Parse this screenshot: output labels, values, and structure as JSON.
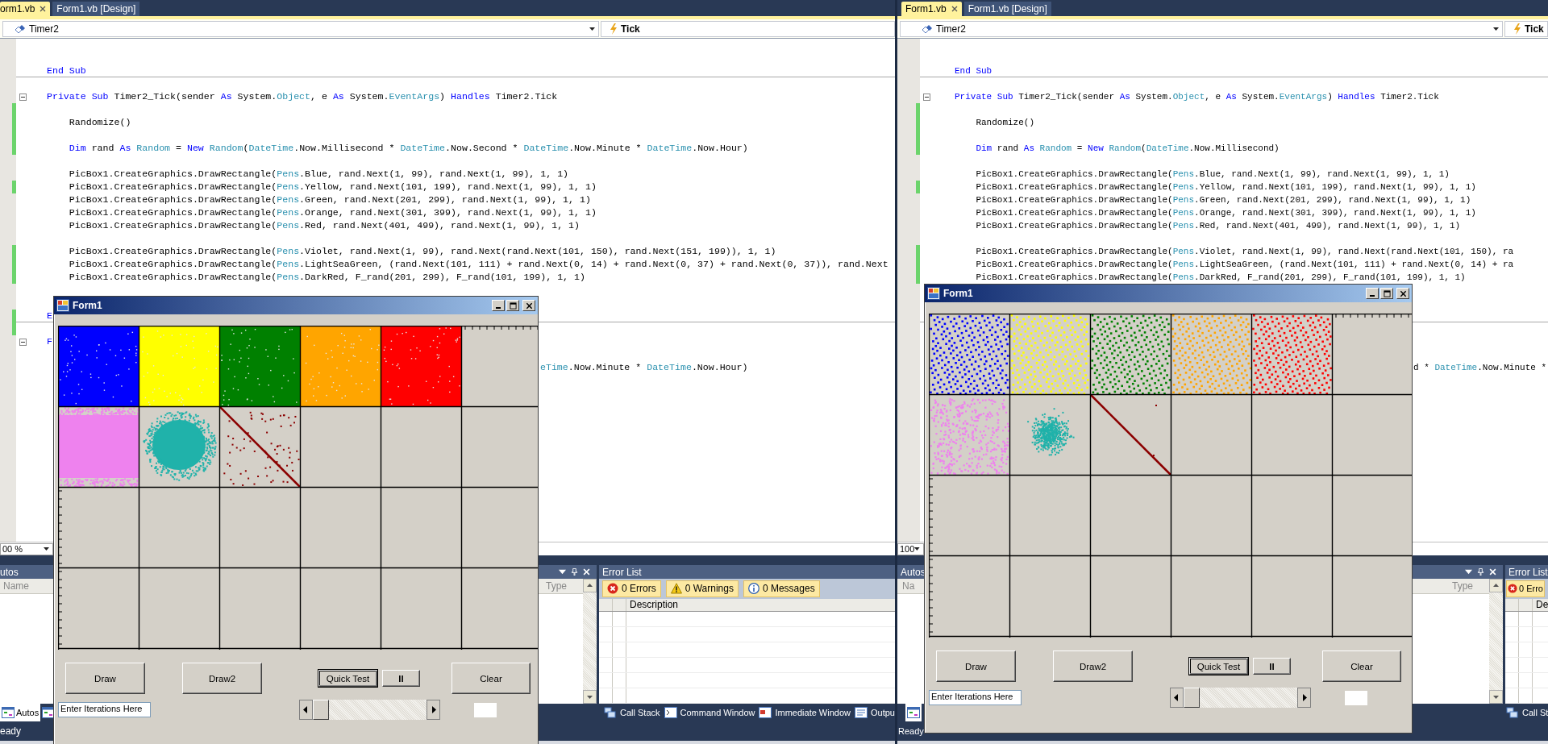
{
  "ides": [
    {
      "tabs": [
        {
          "label": "orm1.vb",
          "selected": true
        },
        {
          "label": "Form1.vb [Design]",
          "selected": false
        }
      ],
      "object_dropdown": "Timer2",
      "event_dropdown": "Tick",
      "code_lines": [
        {
          "kind": "blank",
          "indented": false,
          "changed": false,
          "collapsible": false,
          "divider": false
        },
        {
          "kind": "blank",
          "indented": false,
          "changed": false,
          "collapsible": false,
          "divider": false
        },
        {
          "kind": "code",
          "indented": false,
          "changed": false,
          "collapsible": false,
          "divider": true,
          "tokens": [
            {
              "text": "End Sub",
              "kind": "keyword"
            }
          ]
        },
        {
          "kind": "blank",
          "indented": false,
          "changed": false,
          "collapsible": false,
          "divider": false
        },
        {
          "kind": "code",
          "indented": false,
          "changed": false,
          "collapsible": true,
          "divider": false,
          "tokens": [
            {
              "text": "Private Sub",
              "kind": "keyword"
            },
            {
              "text": " Timer2_Tick(sender ",
              "kind": "plain"
            },
            {
              "text": "As",
              "kind": "keyword"
            },
            {
              "text": " System.",
              "kind": "plain"
            },
            {
              "text": "Object",
              "kind": "type"
            },
            {
              "text": ", e ",
              "kind": "plain"
            },
            {
              "text": "As",
              "kind": "keyword"
            },
            {
              "text": " System.",
              "kind": "plain"
            },
            {
              "text": "EventArgs",
              "kind": "type"
            },
            {
              "text": ") ",
              "kind": "plain"
            },
            {
              "text": "Handles",
              "kind": "keyword"
            },
            {
              "text": " Timer2.Tick",
              "kind": "plain"
            }
          ]
        },
        {
          "kind": "blank",
          "indented": false,
          "changed": true,
          "collapsible": false,
          "divider": false
        },
        {
          "kind": "code",
          "indented": true,
          "changed": true,
          "collapsible": false,
          "divider": false,
          "tokens": [
            {
              "text": "Randomize()",
              "kind": "plain"
            }
          ]
        },
        {
          "kind": "blank",
          "indented": false,
          "changed": true,
          "collapsible": false,
          "divider": false
        },
        {
          "kind": "code",
          "indented": true,
          "changed": true,
          "collapsible": false,
          "divider": false,
          "tokens": [
            {
              "text": "Dim",
              "kind": "keyword"
            },
            {
              "text": " rand ",
              "kind": "plain"
            },
            {
              "text": "As",
              "kind": "keyword"
            },
            {
              "text": " Random",
              "kind": "type"
            },
            {
              "text": " = ",
              "kind": "plain"
            },
            {
              "text": "New",
              "kind": "keyword"
            },
            {
              "text": " Random",
              "kind": "type"
            },
            {
              "text": "(",
              "kind": "plain"
            },
            {
              "text": "DateTime",
              "kind": "type"
            },
            {
              "text": ".Now.Millisecond * ",
              "kind": "plain"
            },
            {
              "text": "DateTime",
              "kind": "type"
            },
            {
              "text": ".Now.Second * ",
              "kind": "plain"
            },
            {
              "text": "DateTime",
              "kind": "type"
            },
            {
              "text": ".Now.Minute * ",
              "kind": "plain"
            },
            {
              "text": "DateTime",
              "kind": "type"
            },
            {
              "text": ".Now.Hour)",
              "kind": "plain"
            }
          ]
        },
        {
          "kind": "blank",
          "indented": false,
          "changed": false,
          "collapsible": false,
          "divider": false
        },
        {
          "kind": "code",
          "indented": true,
          "changed": false,
          "collapsible": false,
          "divider": false,
          "tokens": [
            {
              "text": "PicBox1.CreateGraphics.DrawRectangle(",
              "kind": "plain"
            },
            {
              "text": "Pens",
              "kind": "type"
            },
            {
              "text": ".Blue, rand.Next(1, 99), rand.Next(1, 99), 1, 1)",
              "kind": "plain"
            }
          ]
        },
        {
          "kind": "code",
          "indented": true,
          "changed": true,
          "collapsible": false,
          "divider": false,
          "tokens": [
            {
              "text": "PicBox1.CreateGraphics.DrawRectangle(",
              "kind": "plain"
            },
            {
              "text": "Pens",
              "kind": "type"
            },
            {
              "text": ".Yellow, rand.Next(101, 199), rand.Next(1, 99), 1, 1)",
              "kind": "plain"
            }
          ]
        },
        {
          "kind": "code",
          "indented": true,
          "changed": false,
          "collapsible": false,
          "divider": false,
          "tokens": [
            {
              "text": "PicBox1.CreateGraphics.DrawRectangle(",
              "kind": "plain"
            },
            {
              "text": "Pens",
              "kind": "type"
            },
            {
              "text": ".Green, rand.Next(201, 299), rand.Next(1, 99), 1, 1)",
              "kind": "plain"
            }
          ]
        },
        {
          "kind": "code",
          "indented": true,
          "changed": false,
          "collapsible": false,
          "divider": false,
          "tokens": [
            {
              "text": "PicBox1.CreateGraphics.DrawRectangle(",
              "kind": "plain"
            },
            {
              "text": "Pens",
              "kind": "type"
            },
            {
              "text": ".Orange, rand.Next(301, 399), rand.Next(1, 99), 1, 1)",
              "kind": "plain"
            }
          ]
        },
        {
          "kind": "code",
          "indented": true,
          "changed": false,
          "collapsible": false,
          "divider": false,
          "tokens": [
            {
              "text": "PicBox1.CreateGraphics.DrawRectangle(",
              "kind": "plain"
            },
            {
              "text": "Pens",
              "kind": "type"
            },
            {
              "text": ".Red, rand.Next(401, 499), rand.Next(1, 99), 1, 1)",
              "kind": "plain"
            }
          ]
        },
        {
          "kind": "blank",
          "indented": false,
          "changed": false,
          "collapsible": false,
          "divider": false
        },
        {
          "kind": "code",
          "indented": true,
          "changed": true,
          "collapsible": false,
          "divider": false,
          "tokens": [
            {
              "text": "PicBox1.CreateGraphics.DrawRectangle(",
              "kind": "plain"
            },
            {
              "text": "Pens",
              "kind": "type"
            },
            {
              "text": ".Violet, rand.Next(1, 99), rand.Next(rand.Next(101, 150), rand.Next(151, 199)), 1, 1)",
              "kind": "plain"
            }
          ]
        },
        {
          "kind": "code",
          "indented": true,
          "changed": true,
          "collapsible": false,
          "divider": false,
          "tokens": [
            {
              "text": "PicBox1.CreateGraphics.DrawRectangle(",
              "kind": "plain"
            },
            {
              "text": "Pens",
              "kind": "type"
            },
            {
              "text": ".LightSeaGreen, (rand.Next(101, 111) + rand.Next(0, 14) + rand.Next(0, 37) + rand.Next(0, 37)), rand.Next",
              "kind": "plain"
            }
          ]
        },
        {
          "kind": "code",
          "indented": true,
          "changed": true,
          "collapsible": false,
          "divider": false,
          "tokens": [
            {
              "text": "PicBox1.CreateGraphics.DrawRectangle(",
              "kind": "plain"
            },
            {
              "text": "Pens",
              "kind": "type"
            },
            {
              "text": ".DarkRed, F_rand(201, 299), F_rand(101, 199), 1, 1)",
              "kind": "plain"
            }
          ]
        },
        {
          "kind": "blank",
          "indented": false,
          "changed": false,
          "collapsible": false,
          "divider": false
        },
        {
          "kind": "blank",
          "indented": false,
          "changed": false,
          "collapsible": false,
          "divider": false
        },
        {
          "kind": "code",
          "indented": false,
          "changed": true,
          "collapsible": false,
          "divider": true,
          "tokens": [
            {
              "text": "E",
              "kind": "keyword"
            }
          ]
        },
        {
          "kind": "blank",
          "indented": false,
          "changed": true,
          "collapsible": false,
          "divider": false
        },
        {
          "kind": "code",
          "indented": false,
          "changed": false,
          "collapsible": true,
          "divider": false,
          "tokens": [
            {
              "text": "F",
              "kind": "keyword"
            }
          ]
        },
        {
          "kind": "blank",
          "indented": false,
          "changed": false,
          "collapsible": false,
          "divider": false
        },
        {
          "kind": "tail",
          "indented": false,
          "changed": false,
          "collapsible": false,
          "divider": false,
          "tokens": [
            {
              "text": "eTime",
              "kind": "type"
            },
            {
              "text": ".Now.Minute * ",
              "kind": "plain"
            },
            {
              "text": "DateTime",
              "kind": "type"
            },
            {
              "text": ".Now.Hour)",
              "kind": "plain"
            }
          ]
        }
      ],
      "zoom": "00 %",
      "autos": {
        "title": "utos",
        "columns": [
          "Name",
          "Type"
        ]
      },
      "error_list": {
        "title": "Error List",
        "filters": [
          {
            "kind": "error",
            "label": "0 Errors"
          },
          {
            "kind": "warning",
            "label": "0 Warnings"
          },
          {
            "kind": "info",
            "label": "0 Messages"
          }
        ],
        "columns": [
          "Description"
        ]
      },
      "bottom_tabs": [
        {
          "label": "Autos",
          "selected": true
        },
        {
          "selected": false
        }
      ],
      "tool_tabs": [
        {
          "kind": "stack",
          "label": "Call Stack"
        },
        {
          "kind": "command",
          "label": "Command Window"
        },
        {
          "kind": "immediate",
          "label": "Immediate Window"
        },
        {
          "kind": "output",
          "label": "Outpu"
        }
      ],
      "status": "eady",
      "form": {
        "title": "Form1",
        "cells": [
          {
            "kind": "solid",
            "color": "#0000ff"
          },
          {
            "kind": "solid",
            "color": "#ffff00"
          },
          {
            "kind": "solid",
            "color": "#008000"
          },
          {
            "kind": "solid",
            "color": "#ffa500"
          },
          {
            "kind": "solid",
            "color": "#ff0000"
          },
          {
            "kind": "band",
            "color": "#ee82ee"
          },
          {
            "kind": "blob",
            "color": "#20b2aa"
          },
          {
            "kind": "diagonal",
            "color": "#8b0000"
          }
        ],
        "buttons": [
          {
            "label": "Draw",
            "focused": false
          },
          {
            "label": "Draw2",
            "focused": false
          },
          {
            "label": "Quick Test",
            "focused": true
          },
          {
            "label": "II",
            "focused": false
          },
          {
            "label": "Clear",
            "focused": false
          }
        ],
        "iterations": "Enter Iterations Here"
      }
    },
    {
      "tabs": [
        {
          "label": "Form1.vb",
          "selected": true
        },
        {
          "label": "Form1.vb [Design]",
          "selected": false
        }
      ],
      "object_dropdown": "Timer2",
      "event_dropdown": "Tick",
      "code_lines": [
        {
          "kind": "blank",
          "indented": false,
          "changed": false,
          "collapsible": false,
          "divider": false
        },
        {
          "kind": "blank",
          "indented": false,
          "changed": false,
          "collapsible": false,
          "divider": false
        },
        {
          "kind": "code",
          "indented": false,
          "changed": false,
          "collapsible": false,
          "divider": true,
          "tokens": [
            {
              "text": "End Sub",
              "kind": "keyword"
            }
          ]
        },
        {
          "kind": "blank",
          "indented": false,
          "changed": false,
          "collapsible": false,
          "divider": false
        },
        {
          "kind": "code",
          "indented": false,
          "changed": false,
          "collapsible": true,
          "divider": false,
          "tokens": [
            {
              "text": "Private Sub",
              "kind": "keyword"
            },
            {
              "text": " Timer2_Tick(sender ",
              "kind": "plain"
            },
            {
              "text": "As",
              "kind": "keyword"
            },
            {
              "text": " System.",
              "kind": "plain"
            },
            {
              "text": "Object",
              "kind": "type"
            },
            {
              "text": ", e ",
              "kind": "plain"
            },
            {
              "text": "As",
              "kind": "keyword"
            },
            {
              "text": " System.",
              "kind": "plain"
            },
            {
              "text": "EventArgs",
              "kind": "type"
            },
            {
              "text": ") ",
              "kind": "plain"
            },
            {
              "text": "Handles",
              "kind": "keyword"
            },
            {
              "text": " Timer2.Tick",
              "kind": "plain"
            }
          ]
        },
        {
          "kind": "blank",
          "indented": false,
          "changed": true,
          "collapsible": false,
          "divider": false
        },
        {
          "kind": "code",
          "indented": true,
          "changed": true,
          "collapsible": false,
          "divider": false,
          "tokens": [
            {
              "text": "Randomize()",
              "kind": "plain"
            }
          ]
        },
        {
          "kind": "blank",
          "indented": false,
          "changed": true,
          "collapsible": false,
          "divider": false
        },
        {
          "kind": "code",
          "indented": true,
          "changed": true,
          "collapsible": false,
          "divider": false,
          "tokens": [
            {
              "text": "Dim",
              "kind": "keyword"
            },
            {
              "text": " rand ",
              "kind": "plain"
            },
            {
              "text": "As",
              "kind": "keyword"
            },
            {
              "text": " Random",
              "kind": "type"
            },
            {
              "text": " = ",
              "kind": "plain"
            },
            {
              "text": "New",
              "kind": "keyword"
            },
            {
              "text": " Random",
              "kind": "type"
            },
            {
              "text": "(",
              "kind": "plain"
            },
            {
              "text": "DateTime",
              "kind": "type"
            },
            {
              "text": ".Now.Millisecond)",
              "kind": "plain"
            }
          ]
        },
        {
          "kind": "blank",
          "indented": false,
          "changed": false,
          "collapsible": false,
          "divider": false
        },
        {
          "kind": "code",
          "indented": true,
          "changed": false,
          "collapsible": false,
          "divider": false,
          "tokens": [
            {
              "text": "PicBox1.CreateGraphics.DrawRectangle(",
              "kind": "plain"
            },
            {
              "text": "Pens",
              "kind": "type"
            },
            {
              "text": ".Blue, rand.Next(1, 99), rand.Next(1, 99), 1, 1)",
              "kind": "plain"
            }
          ]
        },
        {
          "kind": "code",
          "indented": true,
          "changed": true,
          "collapsible": false,
          "divider": false,
          "tokens": [
            {
              "text": "PicBox1.CreateGraphics.DrawRectangle(",
              "kind": "plain"
            },
            {
              "text": "Pens",
              "kind": "type"
            },
            {
              "text": ".Yellow, rand.Next(101, 199), rand.Next(1, 99), 1, 1)",
              "kind": "plain"
            }
          ]
        },
        {
          "kind": "code",
          "indented": true,
          "changed": false,
          "collapsible": false,
          "divider": false,
          "tokens": [
            {
              "text": "PicBox1.CreateGraphics.DrawRectangle(",
              "kind": "plain"
            },
            {
              "text": "Pens",
              "kind": "type"
            },
            {
              "text": ".Green, rand.Next(201, 299), rand.Next(1, 99), 1, 1)",
              "kind": "plain"
            }
          ]
        },
        {
          "kind": "code",
          "indented": true,
          "changed": false,
          "collapsible": false,
          "divider": false,
          "tokens": [
            {
              "text": "PicBox1.CreateGraphics.DrawRectangle(",
              "kind": "plain"
            },
            {
              "text": "Pens",
              "kind": "type"
            },
            {
              "text": ".Orange, rand.Next(301, 399), rand.Next(1, 99), 1, 1)",
              "kind": "plain"
            }
          ]
        },
        {
          "kind": "code",
          "indented": true,
          "changed": false,
          "collapsible": false,
          "divider": false,
          "tokens": [
            {
              "text": "PicBox1.CreateGraphics.DrawRectangle(",
              "kind": "plain"
            },
            {
              "text": "Pens",
              "kind": "type"
            },
            {
              "text": ".Red, rand.Next(401, 499), rand.Next(1, 99), 1, 1)",
              "kind": "plain"
            }
          ]
        },
        {
          "kind": "blank",
          "indented": false,
          "changed": false,
          "collapsible": false,
          "divider": false
        },
        {
          "kind": "code",
          "indented": true,
          "changed": true,
          "collapsible": false,
          "divider": false,
          "tokens": [
            {
              "text": "PicBox1.CreateGraphics.DrawRectangle(",
              "kind": "plain"
            },
            {
              "text": "Pens",
              "kind": "type"
            },
            {
              "text": ".Violet, rand.Next(1, 99), rand.Next(rand.Next(101, 150), ra",
              "kind": "plain"
            }
          ]
        },
        {
          "kind": "code",
          "indented": true,
          "changed": true,
          "collapsible": false,
          "divider": false,
          "tokens": [
            {
              "text": "PicBox1.CreateGraphics.DrawRectangle(",
              "kind": "plain"
            },
            {
              "text": "Pens",
              "kind": "type"
            },
            {
              "text": ".LightSeaGreen, (rand.Next(101, 111) + rand.Next(0, 14) + ra",
              "kind": "plain"
            }
          ]
        },
        {
          "kind": "code",
          "indented": true,
          "changed": true,
          "collapsible": false,
          "divider": false,
          "tokens": [
            {
              "text": "PicBox1.CreateGraphics.DrawRectangle(",
              "kind": "plain"
            },
            {
              "text": "Pens",
              "kind": "type"
            },
            {
              "text": ".DarkRed, F_rand(201, 299), F_rand(101, 199), 1, 1)",
              "kind": "plain"
            }
          ]
        },
        {
          "kind": "blank",
          "indented": false,
          "changed": false,
          "collapsible": false,
          "divider": false
        },
        {
          "kind": "blank",
          "indented": false,
          "changed": false,
          "collapsible": false,
          "divider": false
        },
        {
          "kind": "blank",
          "indented": false,
          "changed": false,
          "collapsible": false,
          "divider": true
        },
        {
          "kind": "blank",
          "indented": false,
          "changed": false,
          "collapsible": false,
          "divider": false
        },
        {
          "kind": "blank",
          "indented": false,
          "changed": false,
          "collapsible": false,
          "divider": false
        },
        {
          "kind": "blank",
          "indented": false,
          "changed": false,
          "collapsible": false,
          "divider": false
        },
        {
          "kind": "tail",
          "indented": false,
          "changed": false,
          "collapsible": false,
          "divider": false,
          "tokens": [
            {
              "text": "d * ",
              "kind": "plain"
            },
            {
              "text": "DateTime",
              "kind": "type"
            },
            {
              "text": ".Now.Minute *",
              "kind": "plain"
            }
          ]
        }
      ],
      "zoom": "100",
      "autos": {
        "title": "Autos",
        "columns": [
          "Na",
          "Type"
        ]
      },
      "error_list": {
        "title": "Error List",
        "filters": [
          {
            "kind": "error",
            "label": "0 Erro"
          }
        ],
        "columns": [
          "De"
        ]
      },
      "bottom_tabs": [
        {
          "selected": true
        }
      ],
      "tool_tabs": [
        {
          "kind": "stack",
          "label": "Call St"
        }
      ],
      "status": "Ready",
      "form": {
        "title": "Form1",
        "cells": [
          {
            "kind": "stripes",
            "color": "#0000ff"
          },
          {
            "kind": "stripes",
            "color": "#ffff00"
          },
          {
            "kind": "stripes",
            "color": "#008000"
          },
          {
            "kind": "stripes",
            "color": "#ffa500"
          },
          {
            "kind": "stripes",
            "color": "#ff0000"
          },
          {
            "kind": "scatter",
            "color": "#ee82ee"
          },
          {
            "kind": "cloud",
            "color": "#20b2aa"
          },
          {
            "kind": "line",
            "color": "#8b0000"
          }
        ],
        "buttons": [
          {
            "label": "Draw",
            "focused": false
          },
          {
            "label": "Draw2",
            "focused": false
          },
          {
            "label": "Quick Test",
            "focused": true
          },
          {
            "label": "II",
            "focused": false
          },
          {
            "label": "Clear",
            "focused": false
          }
        ],
        "iterations": "Enter Iterations Here"
      }
    }
  ]
}
